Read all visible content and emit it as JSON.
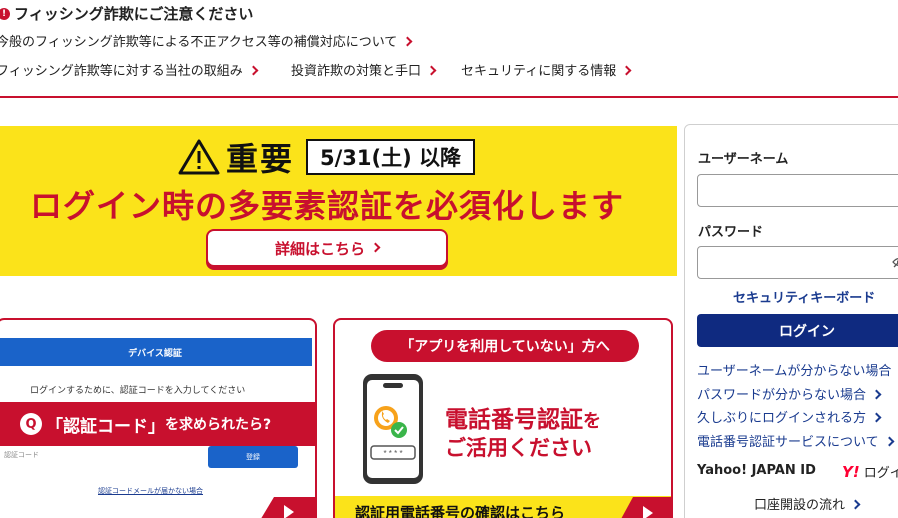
{
  "notice": {
    "title": "フィッシング詐欺にご注意ください",
    "links": [
      "今般のフィッシング詐欺等による不正アクセス等の補償対応について",
      "フィッシング詐欺等に対する当社の取組み",
      "投資詐欺の対策と手口",
      "セキュリティに関する情報"
    ]
  },
  "banner": {
    "important": "重要",
    "date": "5/31(土) 以降",
    "main": "ログイン時の多要素認証を必須化します",
    "button": "詳細はこちら"
  },
  "card_auth_code": {
    "header": "デバイス認証",
    "description": "ログインするために、認証コードを入力してください",
    "q_badge": "Q",
    "band_main": "「認証コード」",
    "band_suffix": "を求められたら?",
    "input_placeholder": "認証コード",
    "submit": "登録",
    "resend": "認証コードメールが届かない場合"
  },
  "card_phone": {
    "pill": "「アプリを利用していない」方へ",
    "title": "電話番号認証",
    "title_suffix": "を",
    "subtitle": "ご活用ください",
    "phone_mask": "* * * *",
    "bottom": "認証用電話番号の確認はこちら"
  },
  "login": {
    "username_label": "ユーザーネーム",
    "password_label": "パスワード",
    "security_keyboard": "セキュリティキーボード",
    "login_button": "ログイン",
    "help_links": [
      "ユーザーネームが分からない場合",
      "パスワードが分からない場合",
      "久しぶりにログインされる方",
      "電話番号認証サービスについて"
    ],
    "yahoo_label": "Yahoo! JAPAN ID",
    "yahoo_logo": "Y!",
    "yahoo_login": "ログイン",
    "open_account": "口座開設の流れ"
  },
  "colors": {
    "accent_red": "#c8102e",
    "banner_yellow": "#fbe31a",
    "login_navy": "#0f2a80",
    "link_blue": "#1a3b8f"
  }
}
